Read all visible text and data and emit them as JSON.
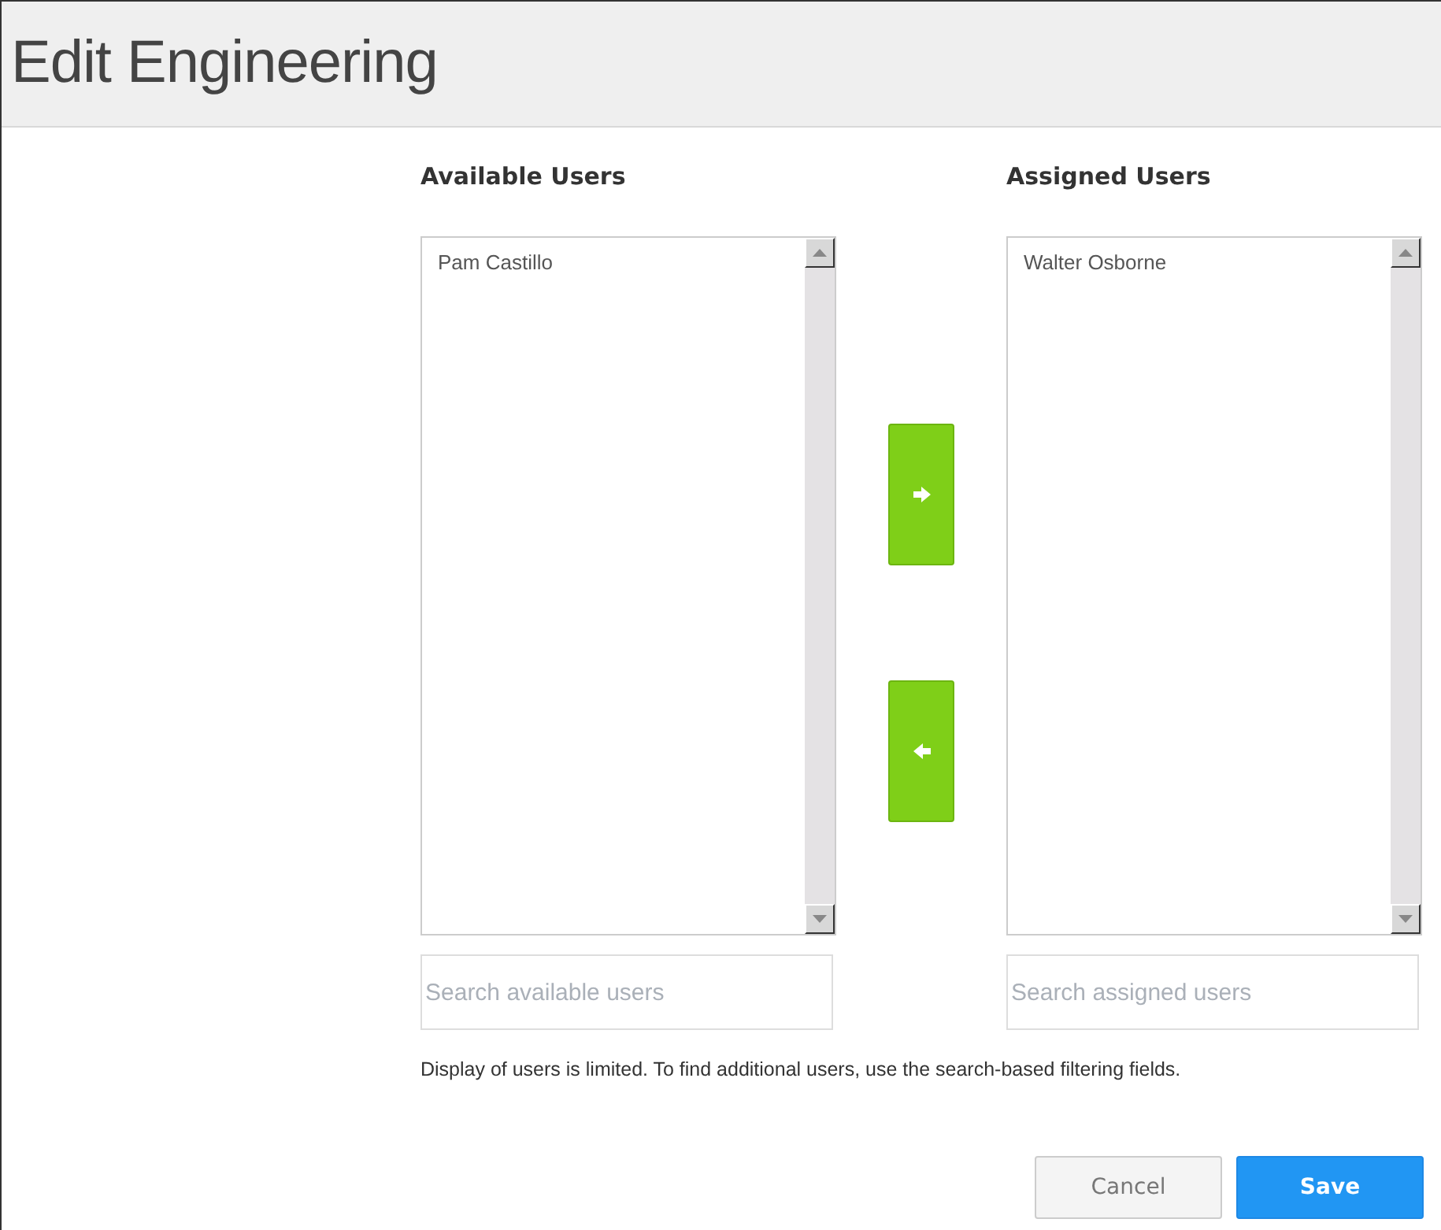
{
  "title": "Edit Engineering",
  "lists": [
    {
      "heading": "Available Users",
      "users": [
        {
          "name": "Pam Castillo"
        }
      ],
      "search": {
        "placeholder": "Search available users"
      }
    },
    {
      "heading": "Assigned Users",
      "users": [
        {
          "name": "Walter Osborne"
        }
      ],
      "search": {
        "placeholder": "Search assigned users"
      }
    }
  ],
  "move_buttons": [
    {
      "kind": "right"
    },
    {
      "kind": "left"
    }
  ],
  "note": "Display of users is limited. To find additional users, use the search-based filtering fields.",
  "buttons": [
    {
      "label": "Cancel",
      "kind": "secondary"
    },
    {
      "label": "Save",
      "kind": "primary"
    }
  ]
}
